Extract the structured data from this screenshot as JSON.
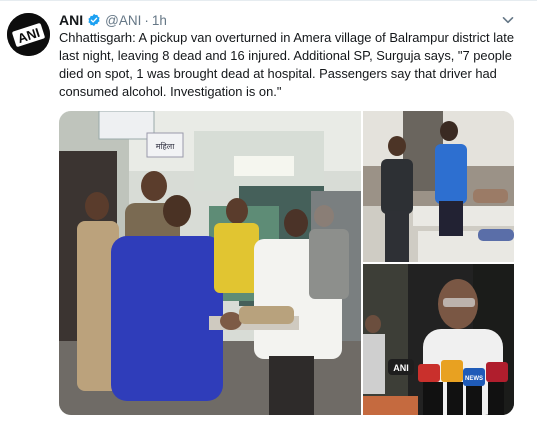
{
  "tweet": {
    "author_name": "ANI",
    "handle": "@ANI",
    "separator": "·",
    "time": "1h",
    "text": "Chhattisgarh: A pickup van overturned in Amera village of Balrampur district late last night, leaving 8 dead and 16 injured. Additional SP, Surguja says, \"7 people died on spot, 1 was brought dead at hospital. Passengers say that driver had consumed alcohol. Investigation is on.\"",
    "avatar_text": "ANI",
    "verified_icon": "verified-badge-icon",
    "menu_icon": "chevron-down-icon",
    "verified_color": "#1da1f2"
  },
  "media": {
    "photos": [
      {
        "name": "hospital-ward-photo",
        "sign_text": "महिला"
      },
      {
        "name": "patients-on-beds-photo"
      },
      {
        "name": "official-interview-photo",
        "mic_labels": [
          "ANI",
          "NEWS"
        ]
      }
    ]
  }
}
